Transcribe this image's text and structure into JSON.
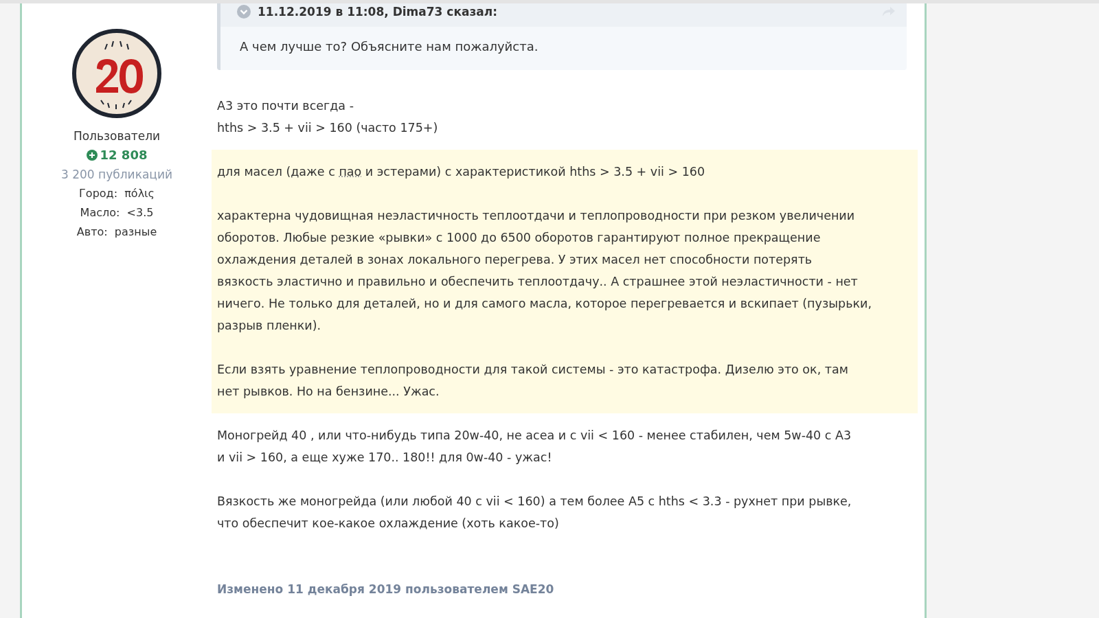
{
  "author": {
    "group": "Пользователи",
    "reputation": "12 808",
    "posts": "3 200 публикаций",
    "fields": [
      {
        "label": "Город:",
        "value": "πόλις"
      },
      {
        "label": "Масло:",
        "value": "<3.5"
      },
      {
        "label": "Авто:",
        "value": "разные"
      }
    ]
  },
  "quote": {
    "header": "11.12.2019 в 11:08, Dima73 сказал:",
    "text": "А чем лучше то? Объясните нам пожалуйста."
  },
  "blocks": [
    {
      "highlight": false,
      "paragraphs": [
        {
          "lines": [
            [
              {
                "text": "А3 это почти всегда -"
              }
            ],
            [
              {
                "text": "hths > 3.5 + vii > 160 (часто 175+)"
              }
            ]
          ]
        }
      ]
    },
    {
      "highlight": true,
      "paragraphs": [
        {
          "lines": [
            [
              {
                "text": "для масел (даже с "
              },
              {
                "text": "пао",
                "abbr": true
              },
              {
                "text": " и эстерами) с характеристикой hths > 3.5 + vii > 160"
              }
            ]
          ]
        },
        {
          "lines": [
            [
              {
                "text": "характерна чудовищная неэластичность теплоотдачи и теплопроводности при резком увеличении"
              }
            ],
            [
              {
                "text": "оборотов. Любые резкие «рывки» с 1000 до 6500 оборотов гарантируют полное прекращение"
              }
            ],
            [
              {
                "text": "охлаждения деталей в зонах локального перегрева. У этих масел нет способности потерять"
              }
            ],
            [
              {
                "text": "вязкость эластично и правильно и обеспечить теплоотдачу.. А страшнее этой неэластичности - нет"
              }
            ],
            [
              {
                "text": "ничего. Не только для деталей, но и для самого масла, которое перегревается и вскипает (пузырьки,"
              }
            ],
            [
              {
                "text": "разрыв пленки)."
              }
            ]
          ]
        },
        {
          "lines": [
            [
              {
                "text": "Если взять уравнение теплопроводности для такой системы - это катастрофа. Дизелю это ок, там"
              }
            ],
            [
              {
                "text": "нет рывков. Но на бензине... Ужас."
              }
            ]
          ]
        }
      ]
    },
    {
      "highlight": false,
      "paragraphs": [
        {
          "lines": [
            [
              {
                "text": "Моногрейд 40 , или что-нибудь типа 20w-40, не асеа и с vii < 160 - менее стабилен, чем 5w-40 с А3"
              }
            ],
            [
              {
                "text": "и vii > 160, а еще хуже 170.. 180!! для 0w-40 - ужас!"
              }
            ]
          ]
        },
        {
          "lines": [
            [
              {
                "text": "Вязкость же моногрейда (или любой 40 с vii < 160) а тем более А5 с hths < 3.3 - рухнет при рывке,"
              }
            ],
            [
              {
                "text": "что обеспечит кое-какое охлаждение (хоть какое-то)"
              }
            ]
          ]
        }
      ]
    }
  ],
  "edited": "Изменено 11 декабря 2019 пользователем SAE20"
}
